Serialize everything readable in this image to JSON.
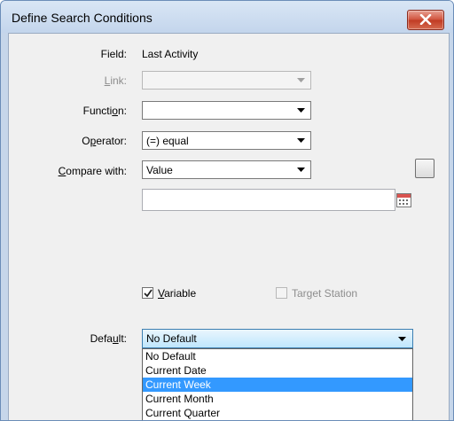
{
  "window": {
    "title": "Define Search Conditions",
    "close_icon": "close-x-icon"
  },
  "field": {
    "label": "Field:",
    "value": "Last Activity"
  },
  "link": {
    "label_pre": "",
    "label_u": "L",
    "label_post": "ink:",
    "value": ""
  },
  "function": {
    "label_pre": "Functi",
    "label_u": "o",
    "label_post": "n:",
    "value": ""
  },
  "operator": {
    "label_pre": "O",
    "label_u": "p",
    "label_post": "erator:",
    "value": "(=) equal"
  },
  "compare": {
    "label_pre": "",
    "label_u": "C",
    "label_post": "ompare with:",
    "value": "Value"
  },
  "compare_value_input": {
    "value": ""
  },
  "variable": {
    "label_pre": "",
    "label_u": "V",
    "label_post": "ariable",
    "checked": true
  },
  "target_station": {
    "label": "Target Station",
    "checked": false
  },
  "default": {
    "label_pre": "Defa",
    "label_u": "u",
    "label_post": "lt:",
    "value": "No Default",
    "options": [
      "No Default",
      "Current Date",
      "Current Week",
      "Current Month",
      "Current Quarter"
    ],
    "highlighted": "Current Week"
  },
  "colors": {
    "selection": "#3399ff",
    "title_bar": "#c3d5ec",
    "close_button": "#c03a22"
  }
}
